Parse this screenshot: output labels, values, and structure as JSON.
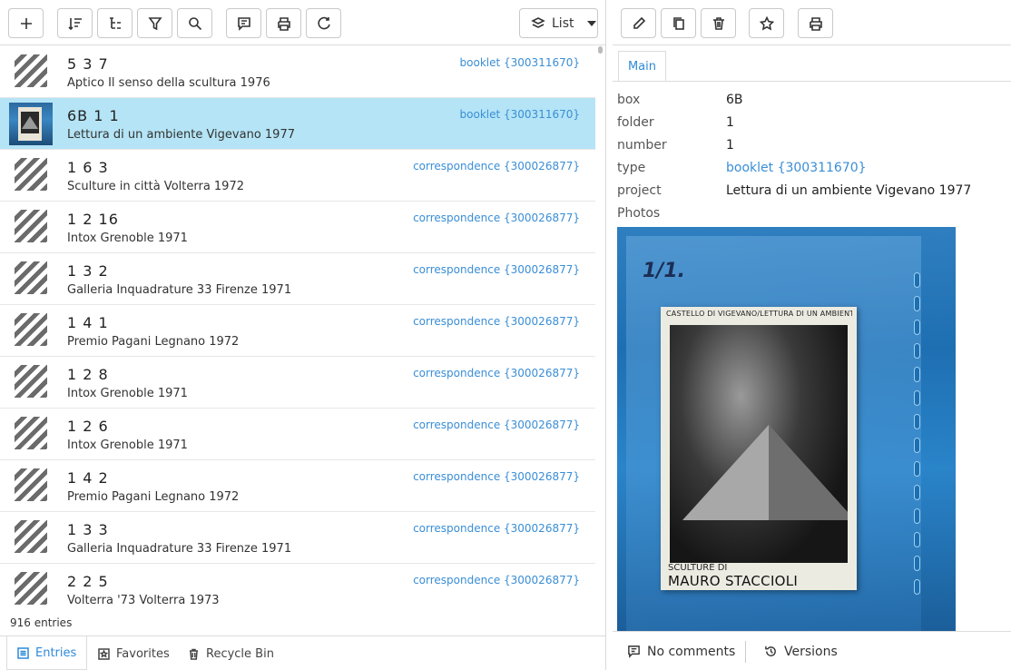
{
  "left_toolbar": {
    "buttons": [
      {
        "name": "add-button",
        "icon": "plus-icon"
      },
      {
        "name": "sort-button",
        "icon": "sort-icon"
      },
      {
        "name": "tree-button",
        "icon": "tree-icon"
      },
      {
        "name": "filter-button",
        "icon": "filter-icon"
      },
      {
        "name": "search-button",
        "icon": "search-icon"
      },
      {
        "name": "comment-button",
        "icon": "comment-icon"
      },
      {
        "name": "print-button",
        "icon": "print-icon"
      },
      {
        "name": "refresh-button",
        "icon": "refresh-icon"
      }
    ],
    "view_select": {
      "label": "List",
      "icon": "layers-icon"
    }
  },
  "entries": [
    {
      "title": "5 3 7",
      "subtitle": "Aptico Il senso della scultura 1976",
      "tag": "booklet {300311670}",
      "thumb": "placeholder"
    },
    {
      "title": "6B 1 1",
      "subtitle": "Lettura di un ambiente Vigevano 1977",
      "tag": "booklet {300311670}",
      "thumb": "photo",
      "selected": true
    },
    {
      "title": "1 6 3",
      "subtitle": "Sculture in città Volterra 1972",
      "tag": "correspondence {300026877}",
      "thumb": "placeholder"
    },
    {
      "title": "1 2 16",
      "subtitle": "Intox Grenoble 1971",
      "tag": "correspondence {300026877}",
      "thumb": "placeholder"
    },
    {
      "title": "1 3 2",
      "subtitle": "Galleria Inquadrature 33 Firenze 1971",
      "tag": "correspondence {300026877}",
      "thumb": "placeholder"
    },
    {
      "title": "1 4 1",
      "subtitle": "Premio Pagani Legnano 1972",
      "tag": "correspondence {300026877}",
      "thumb": "placeholder"
    },
    {
      "title": "1 2 8",
      "subtitle": "Intox Grenoble 1971",
      "tag": "correspondence {300026877}",
      "thumb": "placeholder"
    },
    {
      "title": "1 2 6",
      "subtitle": "Intox Grenoble 1971",
      "tag": "correspondence {300026877}",
      "thumb": "placeholder"
    },
    {
      "title": "1 4 2",
      "subtitle": "Premio Pagani Legnano 1972",
      "tag": "correspondence {300026877}",
      "thumb": "placeholder"
    },
    {
      "title": "1 3 3",
      "subtitle": "Galleria Inquadrature 33 Firenze 1971",
      "tag": "correspondence {300026877}",
      "thumb": "placeholder"
    },
    {
      "title": "2 2 5",
      "subtitle": "Volterra '73 Volterra 1973",
      "tag": "correspondence {300026877}",
      "thumb": "placeholder"
    }
  ],
  "status": {
    "count": "916 entries"
  },
  "bottom_tabs": {
    "entries": "Entries",
    "favorites": "Favorites",
    "recycle_bin": "Recycle Bin"
  },
  "right_toolbar": {
    "buttons": [
      {
        "name": "edit-button",
        "icon": "pencil-icon"
      },
      {
        "name": "copy-button",
        "icon": "copy-icon"
      },
      {
        "name": "delete-button",
        "icon": "trash-icon"
      },
      {
        "name": "favorite-button",
        "icon": "star-icon"
      },
      {
        "name": "print-button",
        "icon": "print-icon"
      }
    ]
  },
  "detail": {
    "tab": "Main",
    "fields": [
      {
        "label": "box",
        "value": "6B"
      },
      {
        "label": "folder",
        "value": "1"
      },
      {
        "label": "number",
        "value": "1"
      },
      {
        "label": "type",
        "value": "booklet {300311670}",
        "link": true
      },
      {
        "label": "project",
        "value": "Lettura di un ambiente Vigevano 1977"
      }
    ],
    "photos_label": "Photos",
    "photo": {
      "handwriting": "1/1.",
      "booklet_header": "CASTELLO DI VIGEVANO/LETTURA DI UN AMBIENTE",
      "booklet_line1": "SCULTURE DI",
      "booklet_line2": "MAURO STACCIOLI"
    }
  },
  "right_bottom": {
    "comments": "No comments",
    "versions": "Versions"
  },
  "colors": {
    "accent": "#2f8ad8",
    "selected_row": "#b4e4f5",
    "link": "#3a8ed6"
  }
}
